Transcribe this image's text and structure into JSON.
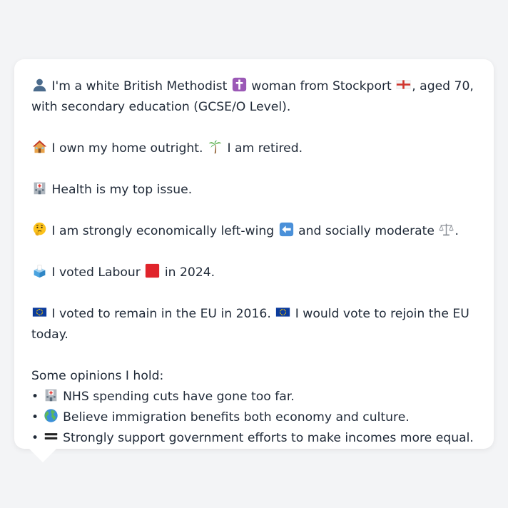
{
  "profile": {
    "identity": {
      "before_religion": "I'm a white British Methodist",
      "before_place": "woman from Stockport",
      "after_place": ", aged 70, with secondary education (GCSE/O Level)."
    },
    "housing": {
      "home": "I own my home outright.",
      "work": "I am retired."
    },
    "issue": "Health is my top issue.",
    "politics": {
      "economic": "I am strongly economically left-wing",
      "social": "and socially moderate",
      "end": "."
    },
    "vote": {
      "before": "I voted Labour",
      "after": "in 2024."
    },
    "eu": {
      "remain": "I voted to remain in the EU in 2016.",
      "rejoin": "I would vote to rejoin the EU today."
    },
    "opinions_heading": "Some opinions I hold:",
    "opinions": [
      "NHS spending cuts have gone too far.",
      "Believe immigration benefits both economy and culture.",
      "Strongly support government efforts to make incomes more equal."
    ],
    "bullet": "•"
  },
  "icons": {
    "person": "bust-silhouette-icon",
    "religion": "latin-cross-icon",
    "place": "england-flag-icon",
    "home": "house-icon",
    "retired": "palm-tree-icon",
    "health": "hospital-icon",
    "thinking": "thinking-face-icon",
    "left": "left-arrow-icon",
    "moderate": "balance-scale-icon",
    "vote": "ballot-box-icon",
    "party": "red-square-icon",
    "eu": "eu-flag-icon",
    "globe": "globe-icon",
    "equal": "heavy-equals-icon"
  },
  "colors": {
    "background": "#f3f4f6",
    "bubble": "#ffffff",
    "text": "#1f2937",
    "labour_red": "#e0242b",
    "eu_blue": "#0b3b9c"
  }
}
